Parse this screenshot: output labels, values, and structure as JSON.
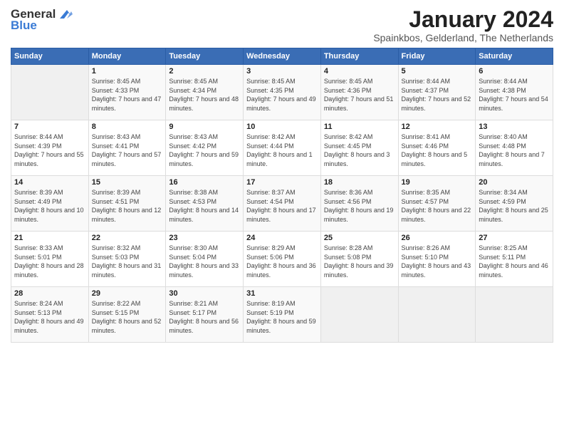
{
  "logo": {
    "general": "General",
    "blue": "Blue"
  },
  "title": "January 2024",
  "location": "Spainkbos, Gelderland, The Netherlands",
  "days_header": [
    "Sunday",
    "Monday",
    "Tuesday",
    "Wednesday",
    "Thursday",
    "Friday",
    "Saturday"
  ],
  "weeks": [
    {
      "cells": [
        {
          "num": "",
          "empty": true
        },
        {
          "num": "1",
          "sunrise": "8:45 AM",
          "sunset": "4:33 PM",
          "daylight": "7 hours and 47 minutes."
        },
        {
          "num": "2",
          "sunrise": "8:45 AM",
          "sunset": "4:34 PM",
          "daylight": "7 hours and 48 minutes."
        },
        {
          "num": "3",
          "sunrise": "8:45 AM",
          "sunset": "4:35 PM",
          "daylight": "7 hours and 49 minutes."
        },
        {
          "num": "4",
          "sunrise": "8:45 AM",
          "sunset": "4:36 PM",
          "daylight": "7 hours and 51 minutes."
        },
        {
          "num": "5",
          "sunrise": "8:44 AM",
          "sunset": "4:37 PM",
          "daylight": "7 hours and 52 minutes."
        },
        {
          "num": "6",
          "sunrise": "8:44 AM",
          "sunset": "4:38 PM",
          "daylight": "7 hours and 54 minutes."
        }
      ]
    },
    {
      "cells": [
        {
          "num": "7",
          "sunrise": "8:44 AM",
          "sunset": "4:39 PM",
          "daylight": "7 hours and 55 minutes."
        },
        {
          "num": "8",
          "sunrise": "8:43 AM",
          "sunset": "4:41 PM",
          "daylight": "7 hours and 57 minutes."
        },
        {
          "num": "9",
          "sunrise": "8:43 AM",
          "sunset": "4:42 PM",
          "daylight": "7 hours and 59 minutes."
        },
        {
          "num": "10",
          "sunrise": "8:42 AM",
          "sunset": "4:44 PM",
          "daylight": "8 hours and 1 minute."
        },
        {
          "num": "11",
          "sunrise": "8:42 AM",
          "sunset": "4:45 PM",
          "daylight": "8 hours and 3 minutes."
        },
        {
          "num": "12",
          "sunrise": "8:41 AM",
          "sunset": "4:46 PM",
          "daylight": "8 hours and 5 minutes."
        },
        {
          "num": "13",
          "sunrise": "8:40 AM",
          "sunset": "4:48 PM",
          "daylight": "8 hours and 7 minutes."
        }
      ]
    },
    {
      "cells": [
        {
          "num": "14",
          "sunrise": "8:39 AM",
          "sunset": "4:49 PM",
          "daylight": "8 hours and 10 minutes."
        },
        {
          "num": "15",
          "sunrise": "8:39 AM",
          "sunset": "4:51 PM",
          "daylight": "8 hours and 12 minutes."
        },
        {
          "num": "16",
          "sunrise": "8:38 AM",
          "sunset": "4:53 PM",
          "daylight": "8 hours and 14 minutes."
        },
        {
          "num": "17",
          "sunrise": "8:37 AM",
          "sunset": "4:54 PM",
          "daylight": "8 hours and 17 minutes."
        },
        {
          "num": "18",
          "sunrise": "8:36 AM",
          "sunset": "4:56 PM",
          "daylight": "8 hours and 19 minutes."
        },
        {
          "num": "19",
          "sunrise": "8:35 AM",
          "sunset": "4:57 PM",
          "daylight": "8 hours and 22 minutes."
        },
        {
          "num": "20",
          "sunrise": "8:34 AM",
          "sunset": "4:59 PM",
          "daylight": "8 hours and 25 minutes."
        }
      ]
    },
    {
      "cells": [
        {
          "num": "21",
          "sunrise": "8:33 AM",
          "sunset": "5:01 PM",
          "daylight": "8 hours and 28 minutes."
        },
        {
          "num": "22",
          "sunrise": "8:32 AM",
          "sunset": "5:03 PM",
          "daylight": "8 hours and 31 minutes."
        },
        {
          "num": "23",
          "sunrise": "8:30 AM",
          "sunset": "5:04 PM",
          "daylight": "8 hours and 33 minutes."
        },
        {
          "num": "24",
          "sunrise": "8:29 AM",
          "sunset": "5:06 PM",
          "daylight": "8 hours and 36 minutes."
        },
        {
          "num": "25",
          "sunrise": "8:28 AM",
          "sunset": "5:08 PM",
          "daylight": "8 hours and 39 minutes."
        },
        {
          "num": "26",
          "sunrise": "8:26 AM",
          "sunset": "5:10 PM",
          "daylight": "8 hours and 43 minutes."
        },
        {
          "num": "27",
          "sunrise": "8:25 AM",
          "sunset": "5:11 PM",
          "daylight": "8 hours and 46 minutes."
        }
      ]
    },
    {
      "cells": [
        {
          "num": "28",
          "sunrise": "8:24 AM",
          "sunset": "5:13 PM",
          "daylight": "8 hours and 49 minutes."
        },
        {
          "num": "29",
          "sunrise": "8:22 AM",
          "sunset": "5:15 PM",
          "daylight": "8 hours and 52 minutes."
        },
        {
          "num": "30",
          "sunrise": "8:21 AM",
          "sunset": "5:17 PM",
          "daylight": "8 hours and 56 minutes."
        },
        {
          "num": "31",
          "sunrise": "8:19 AM",
          "sunset": "5:19 PM",
          "daylight": "8 hours and 59 minutes."
        },
        {
          "num": "",
          "empty": true
        },
        {
          "num": "",
          "empty": true
        },
        {
          "num": "",
          "empty": true
        }
      ]
    }
  ],
  "labels": {
    "sunrise": "Sunrise:",
    "sunset": "Sunset:",
    "daylight": "Daylight:"
  }
}
